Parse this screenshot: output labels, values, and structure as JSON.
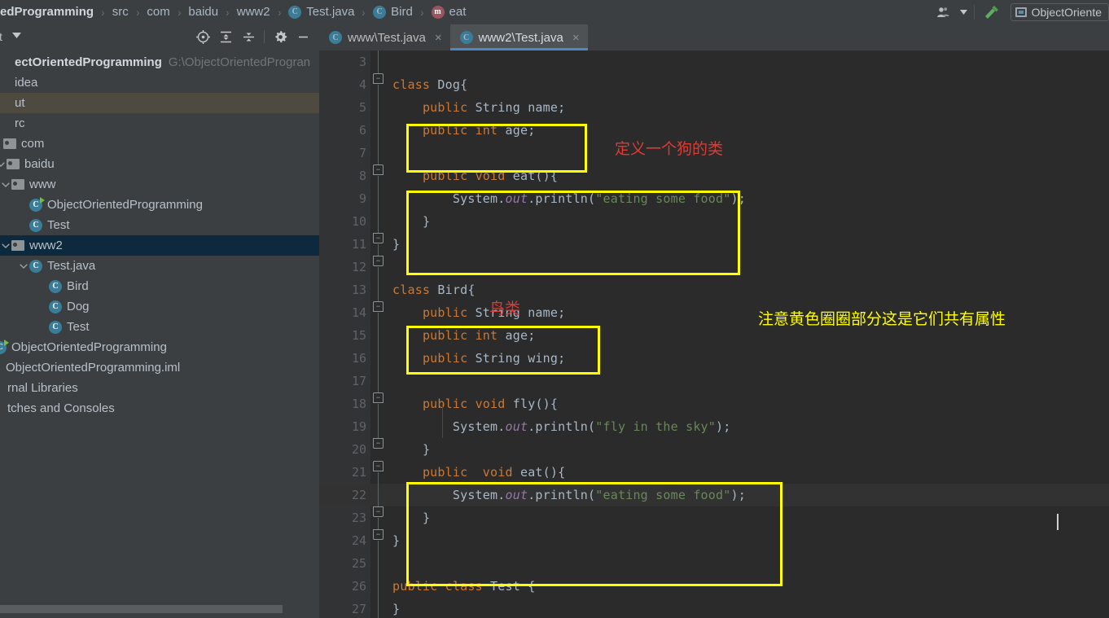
{
  "breadcrumb": {
    "items": [
      {
        "label": "edProgramming",
        "icon": "",
        "bold": true
      },
      {
        "label": "src",
        "icon": "",
        "bold": false
      },
      {
        "label": "com",
        "icon": "",
        "bold": false
      },
      {
        "label": "baidu",
        "icon": "",
        "bold": false
      },
      {
        "label": "www2",
        "icon": "",
        "bold": false
      },
      {
        "label": "Test.java",
        "icon": "class-icon",
        "bold": false
      },
      {
        "label": "Bird",
        "icon": "class-icon",
        "bold": false
      },
      {
        "label": "eat",
        "icon": "method-icon",
        "bold": false
      }
    ],
    "separator": "›"
  },
  "toolbar_right": {
    "user_icon": "user-avatar-icon",
    "dropdown_icon": "chevron-down-icon",
    "build_icon": "hammer-icon",
    "run_config": {
      "label": "ObjectOriente",
      "icon": "run-configuration-icon"
    }
  },
  "sidebar": {
    "title": "ct",
    "caret": "▾",
    "tools": [
      {
        "name": "locate-icon",
        "glyph": "⊕"
      },
      {
        "name": "expand-all-icon",
        "glyph": "⇳"
      },
      {
        "name": "collapse-all-icon",
        "glyph": "⇵"
      },
      {
        "name": "settings-gear-icon",
        "glyph": "⚙"
      },
      {
        "name": "hide-panel-icon",
        "glyph": "—"
      }
    ],
    "tree": [
      {
        "label": "ectOrientedProgramming",
        "hint": "G:\\ObjectOrientedProgran",
        "type": "project",
        "indent": 0,
        "bold": true,
        "arrow": "",
        "state": "normal"
      },
      {
        "label": "idea",
        "type": "folder-plain",
        "indent": 0,
        "arrow": "",
        "state": "normal"
      },
      {
        "label": "ut",
        "type": "folder-plain",
        "indent": 0,
        "arrow": "",
        "state": "out"
      },
      {
        "label": "rc",
        "type": "folder-plain",
        "indent": 0,
        "arrow": "",
        "state": "normal"
      },
      {
        "label": "com",
        "type": "folder",
        "indent": 0,
        "arrow": "",
        "state": "normal"
      },
      {
        "label": "baidu",
        "type": "folder",
        "indent": 0,
        "arrow": "⌄",
        "state": "normal"
      },
      {
        "label": "www",
        "type": "folder",
        "indent": 1,
        "arrow": "⌄",
        "state": "normal"
      },
      {
        "label": "ObjectOrientedProgramming",
        "type": "class-run",
        "indent": 2,
        "arrow": "",
        "state": "normal"
      },
      {
        "label": "Test",
        "type": "class",
        "indent": 2,
        "arrow": "",
        "state": "normal"
      },
      {
        "label": "www2",
        "type": "folder",
        "indent": 1,
        "arrow": "⌄",
        "state": "selected"
      },
      {
        "label": "Test.java",
        "type": "class",
        "indent": 2,
        "arrow": "⌄",
        "state": "normal"
      },
      {
        "label": "Bird",
        "type": "class",
        "indent": 3,
        "arrow": "",
        "state": "normal"
      },
      {
        "label": "Dog",
        "type": "class",
        "indent": 3,
        "arrow": "",
        "state": "normal"
      },
      {
        "label": "Test",
        "type": "class",
        "indent": 3,
        "arrow": "",
        "state": "normal"
      },
      {
        "label": "ObjectOrientedProgramming",
        "type": "class-run",
        "indent": 0,
        "arrow": "",
        "state": "normal"
      },
      {
        "label": "ObjectOrientedProgramming.iml",
        "type": "file",
        "indent": 0,
        "arrow": "",
        "state": "normal"
      },
      {
        "label": "rnal Libraries",
        "type": "library",
        "indent": 0,
        "arrow": "",
        "state": "normal"
      },
      {
        "label": "tches and Consoles",
        "type": "library",
        "indent": 0,
        "arrow": "",
        "state": "normal"
      }
    ]
  },
  "editor": {
    "tabs": [
      {
        "label": "www\\Test.java",
        "icon": "class-icon",
        "close": "×",
        "active": false
      },
      {
        "label": "www2\\Test.java",
        "icon": "class-icon",
        "close": "×",
        "active": true
      }
    ],
    "first_line_number": 3,
    "current_line": 22,
    "lines": [
      {
        "n": 3,
        "text": ""
      },
      {
        "n": 4,
        "text": "class Dog{"
      },
      {
        "n": 5,
        "text": "    public String name;"
      },
      {
        "n": 6,
        "text": "    public int age;"
      },
      {
        "n": 7,
        "text": ""
      },
      {
        "n": 8,
        "text": "    public void eat(){"
      },
      {
        "n": 9,
        "text": "        System.out.println(\"eating some food\");"
      },
      {
        "n": 10,
        "text": "    }"
      },
      {
        "n": 11,
        "text": "}"
      },
      {
        "n": 12,
        "text": ""
      },
      {
        "n": 13,
        "text": "class Bird{"
      },
      {
        "n": 14,
        "text": "    public String name;"
      },
      {
        "n": 15,
        "text": "    public int age;"
      },
      {
        "n": 16,
        "text": "    public String wing;"
      },
      {
        "n": 17,
        "text": ""
      },
      {
        "n": 18,
        "text": "    public void fly(){"
      },
      {
        "n": 19,
        "text": "        System.out.println(\"fly in the sky\");"
      },
      {
        "n": 20,
        "text": "    }"
      },
      {
        "n": 21,
        "text": "    public  void eat(){"
      },
      {
        "n": 22,
        "text": "        System.out.println(\"eating some food\");"
      },
      {
        "n": 23,
        "text": "    }"
      },
      {
        "n": 24,
        "text": "}"
      },
      {
        "n": 25,
        "text": ""
      },
      {
        "n": 26,
        "text": "public class Test {"
      },
      {
        "n": 27,
        "text": "}"
      }
    ]
  },
  "annotations": [
    {
      "name": "dog-class-note",
      "text": "定义一个狗的类",
      "color": "#e03a32"
    },
    {
      "name": "bird-class-note",
      "text": "鸟类",
      "color": "#e03a32"
    },
    {
      "name": "shared-attributes-note",
      "text": "注意黄色圈圈部分这是它们共有属性",
      "color": "#ffff00"
    }
  ],
  "highlight_boxes": [
    {
      "name": "dog-fields-box",
      "color": "#ffff00"
    },
    {
      "name": "dog-eat-method-box",
      "color": "#ffff00"
    },
    {
      "name": "bird-fields-box",
      "color": "#ffff00"
    },
    {
      "name": "bird-eat-method-box",
      "color": "#ffff00"
    }
  ],
  "colors": {
    "editor_bg": "#2b2b2b",
    "panel_bg": "#3c3f41",
    "gutter_bg": "#313335",
    "selection": "#0d293e",
    "tab_active": "#4e5254",
    "tab_underline": "#4a88c7",
    "keyword": "#cc7832",
    "string": "#6a8759",
    "field": "#9876aa",
    "text": "#a9b7c6",
    "annotation_yellow": "#ffff00",
    "annotation_red": "#e03a32"
  }
}
